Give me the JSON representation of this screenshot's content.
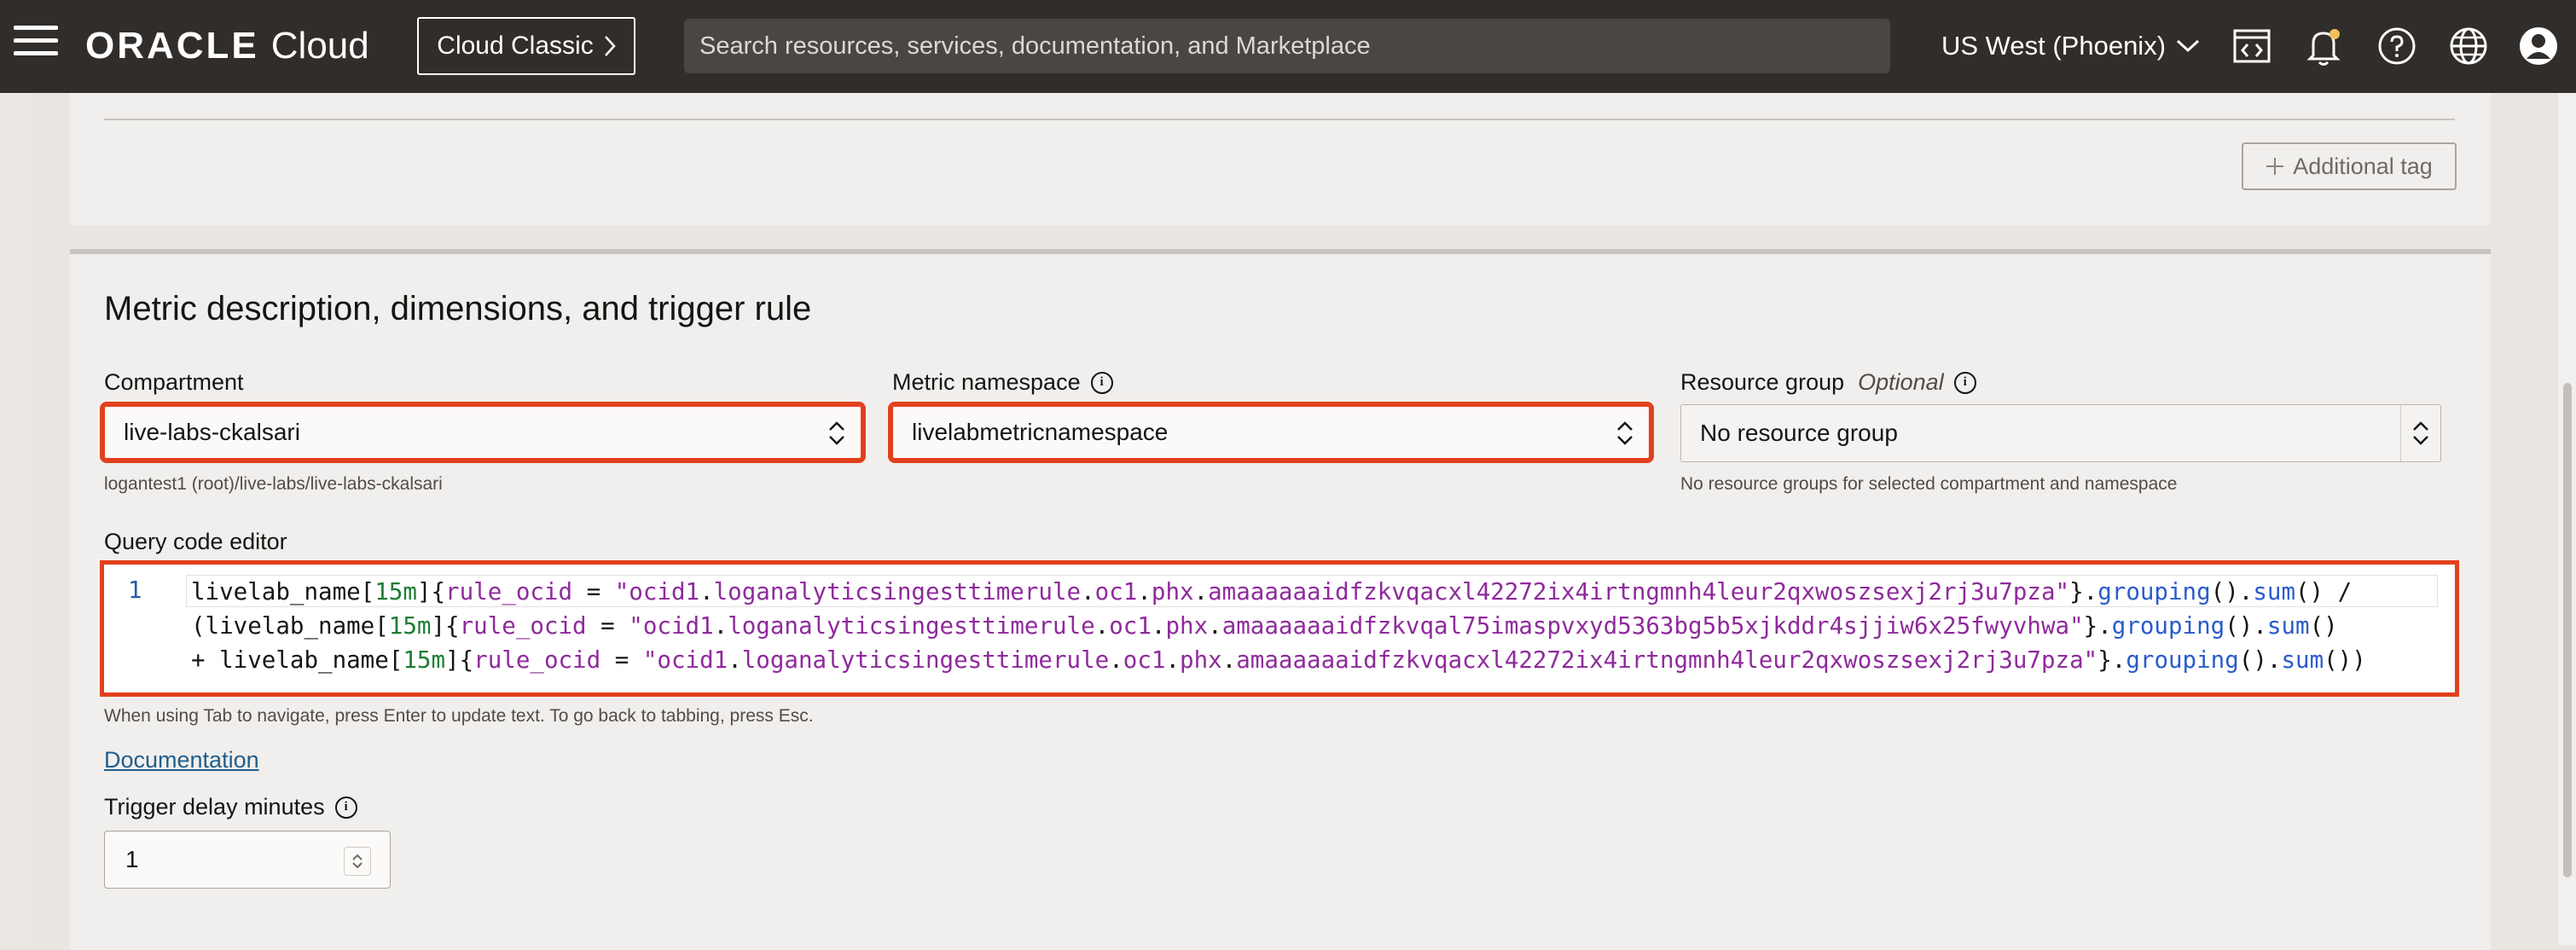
{
  "topbar": {
    "logo_brand": "ORACLE",
    "logo_product": "Cloud",
    "classic_button": "Cloud Classic",
    "search_placeholder": "Search resources, services, documentation, and Marketplace",
    "region": "US West (Phoenix)",
    "icons": [
      "menu-icon",
      "code-editor-icon",
      "bell-icon",
      "help-icon",
      "globe-icon",
      "profile-icon"
    ]
  },
  "tags": {
    "additional_tag_label": "Additional tag"
  },
  "metric_section": {
    "title": "Metric description, dimensions, and trigger rule",
    "compartment": {
      "label": "Compartment",
      "value": "live-labs-ckalsari",
      "helper": "logantest1 (root)/live-labs/live-labs-ckalsari"
    },
    "namespace": {
      "label": "Metric namespace",
      "value": "livelabmetricnamespace"
    },
    "resource_group": {
      "label": "Resource group",
      "optional": "Optional",
      "value": "No resource group",
      "helper": "No resource groups for selected compartment and namespace"
    },
    "query_editor": {
      "label": "Query code editor",
      "line_number": "1",
      "helper": "When using Tab to navigate, press Enter to update text. To go back to tabbing, press Esc."
    },
    "documentation_link": "Documentation",
    "trigger_delay": {
      "label": "Trigger delay minutes",
      "value": "1"
    }
  },
  "colors": {
    "topbar_bg": "#312d2a",
    "highlight": "#e2401c",
    "link": "#1f5e8e"
  }
}
